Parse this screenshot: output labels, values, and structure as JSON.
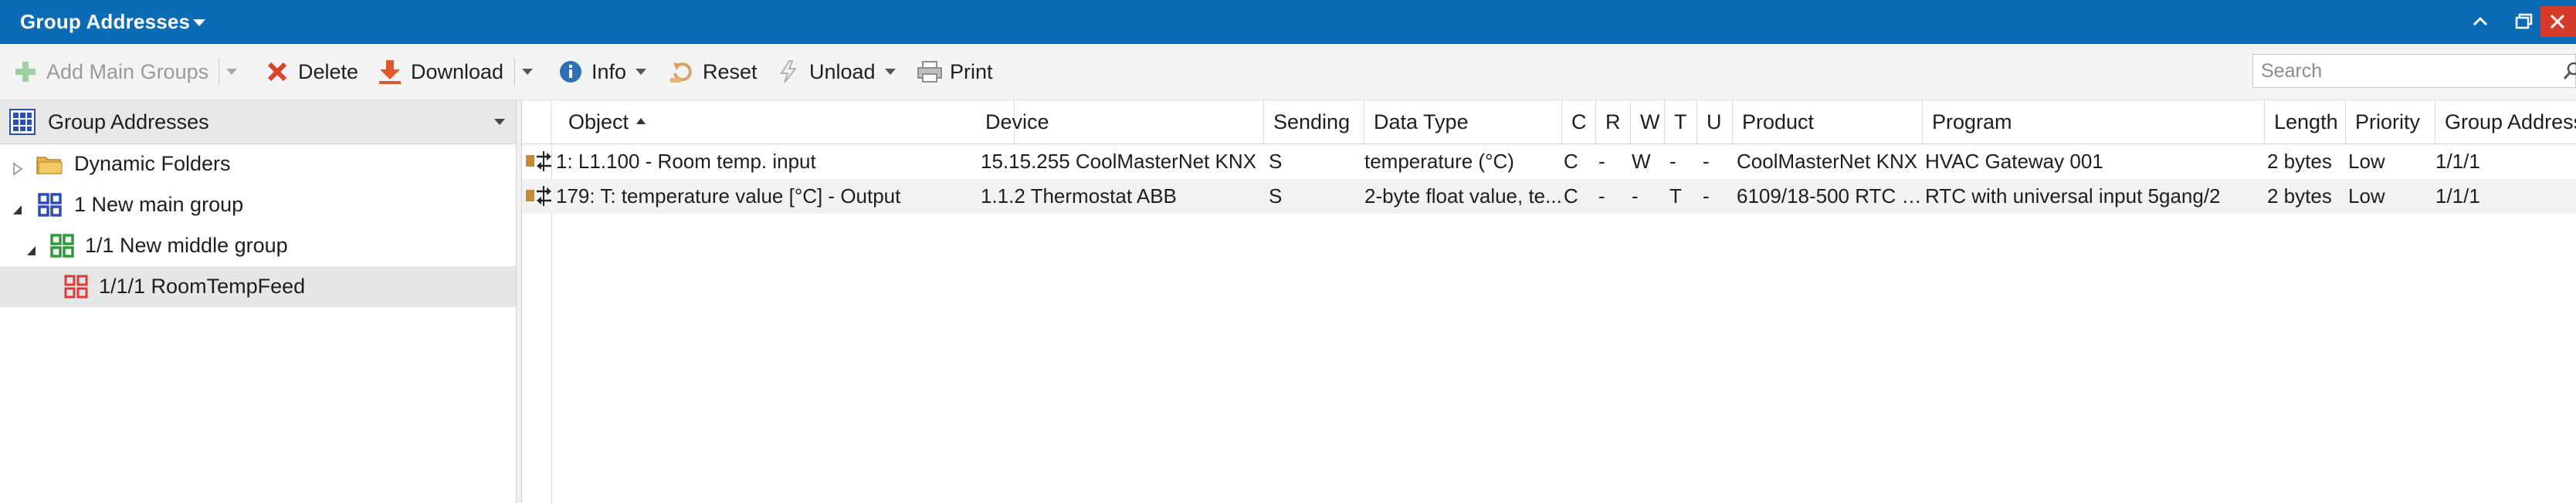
{
  "window": {
    "title": "Group Addresses"
  },
  "toolbar": {
    "add_main_groups": "Add Main Groups",
    "delete": "Delete",
    "download": "Download",
    "info": "Info",
    "reset": "Reset",
    "unload": "Unload",
    "print": "Print",
    "search_placeholder": "Search"
  },
  "tree": {
    "header": "Group Addresses",
    "items": [
      {
        "label": "Dynamic Folders"
      },
      {
        "label": "1 New main group"
      },
      {
        "label": "1/1 New middle group"
      },
      {
        "label": "1/1/1 RoomTempFeed"
      }
    ]
  },
  "grid": {
    "columns": [
      "Object",
      "Device",
      "Sending",
      "Data Type",
      "C",
      "R",
      "W",
      "T",
      "U",
      "Product",
      "Program",
      "Length",
      "Priority",
      "Group Address"
    ],
    "rows": [
      [
        "1: L1.100 - Room temp. input",
        "15.15.255 CoolMasterNet KNX",
        "S",
        "temperature (°C)",
        "C",
        "-",
        "W",
        "-",
        "-",
        "CoolMasterNet KNX",
        "HVAC Gateway 001",
        "2 bytes",
        "Low",
        "1/1/1"
      ],
      [
        "179: T: temperature value [°C] - Output",
        "1.1.2 Thermostat ABB",
        "S",
        "2-byte float value, te...",
        "C",
        "-",
        "-",
        "T",
        "-",
        "6109/18-500 RTC wi...",
        "RTC with universal input 5gang/2",
        "2 bytes",
        "Low",
        "1/1/1"
      ]
    ]
  },
  "colors": {
    "titlebar": "#0a6cb6",
    "close_button": "#d63a2a",
    "delete_red": "#d9452b",
    "download_orange": "#e0592a",
    "info_blue": "#2e6fb7",
    "group_green": "#2f9a3a",
    "group_blue": "#2b4fb8",
    "group_red": "#d83b3b"
  }
}
